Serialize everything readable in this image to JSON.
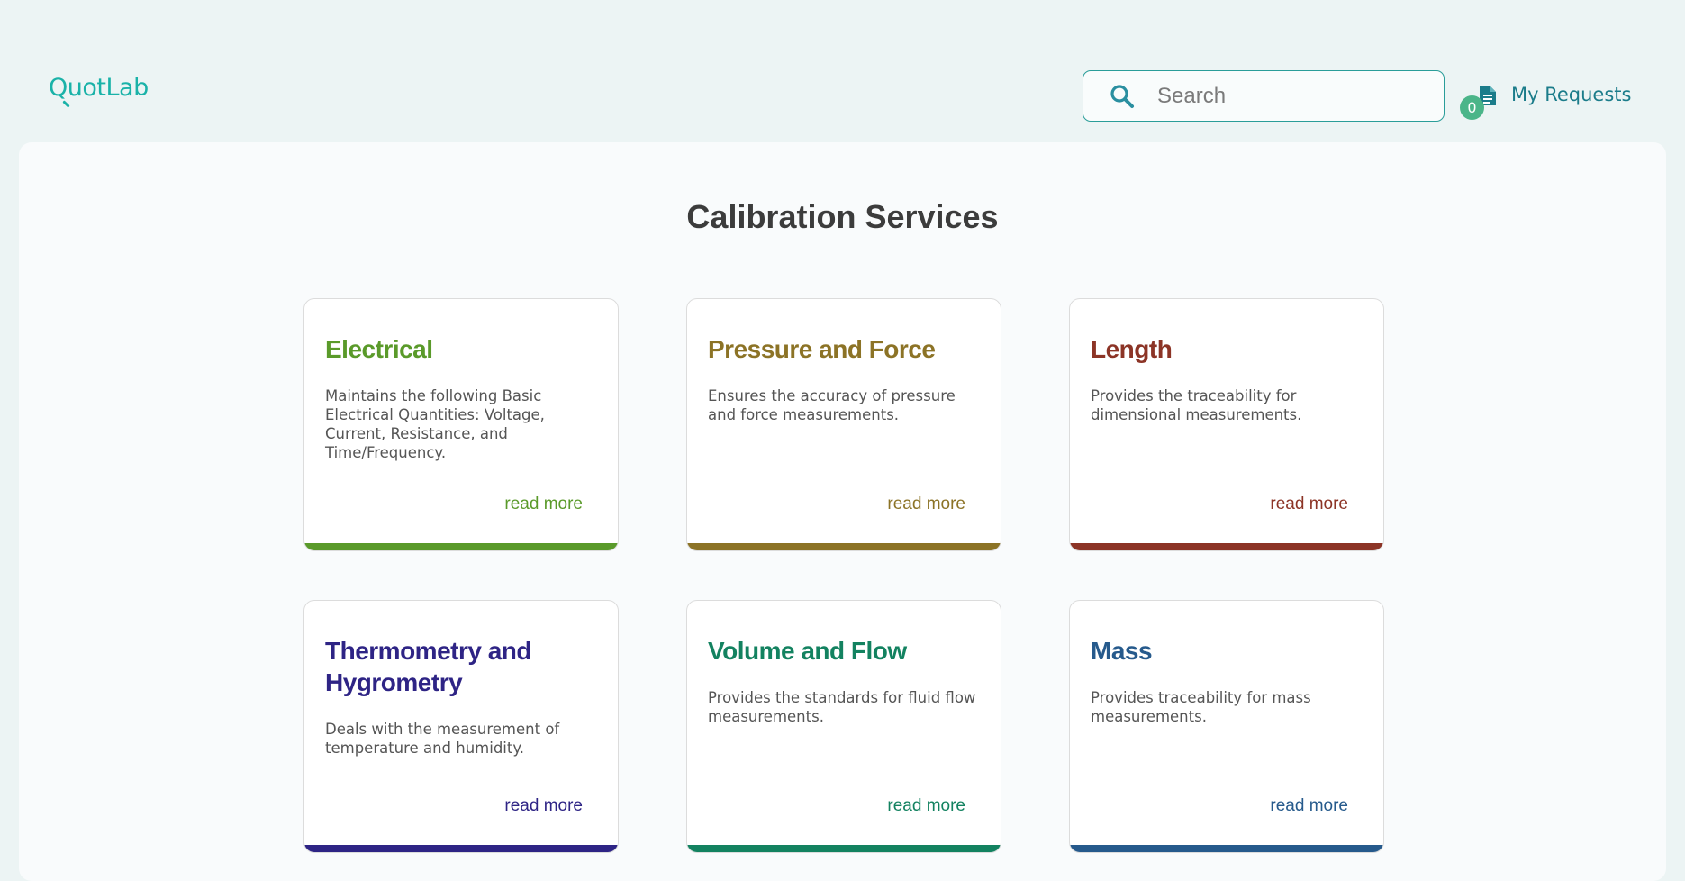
{
  "header": {
    "logo_text": "QuotLab",
    "logo_first": "Q",
    "logo_rest": "uotLab",
    "logo_color": "#1ab2a8",
    "search_placeholder": "Search",
    "requests_label": "My Requests",
    "requests_count": "0"
  },
  "main": {
    "title": "Calibration Services",
    "cards": [
      {
        "title": "Electrical",
        "description": "Maintains the following Basic Electrical Quantities: Voltage, Current, Resistance, and Time/Frequency.",
        "link": "read more",
        "color": "#5a9a2a"
      },
      {
        "title": "Pressure and Force",
        "description": "Ensures the accuracy of pressure and force measurements.",
        "link": "read more",
        "color": "#8c7326"
      },
      {
        "title": "Length",
        "description": "Provides the traceability for dimensional measurements.",
        "link": "read more",
        "color": "#8c3426"
      },
      {
        "title": "Thermometry and Hygrometry",
        "description": "Deals with the measurement of temperature and humidity.",
        "link": "read more",
        "color": "#2e2485"
      },
      {
        "title": "Volume and Flow",
        "description": "Provides the standards for fluid flow measurements.",
        "link": "read more",
        "color": "#138260"
      },
      {
        "title": "Mass",
        "description": "Provides traceability for mass measurements.",
        "link": "read more",
        "color": "#265a8c"
      }
    ]
  }
}
